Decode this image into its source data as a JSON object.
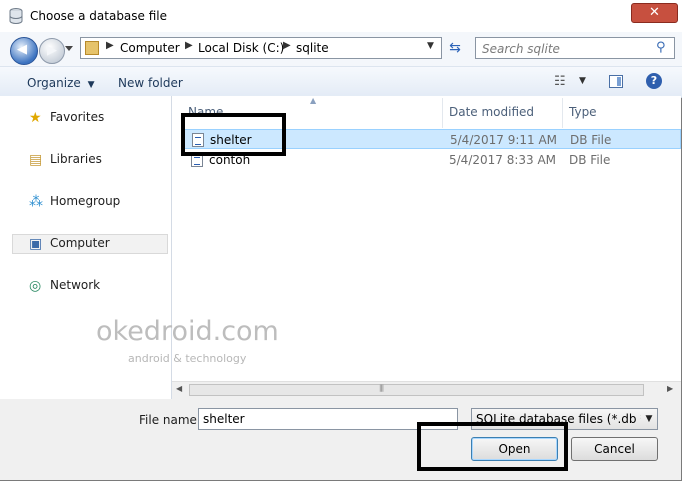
{
  "window": {
    "title": "Choose a database file",
    "close_glyph": "✕"
  },
  "address": {
    "crumbs": [
      "Computer",
      "Local Disk (C:)",
      "sqlite"
    ]
  },
  "search": {
    "placeholder": "Search sqlite"
  },
  "toolbar": {
    "organize_label": "Organize",
    "new_folder_label": "New folder"
  },
  "sidebar": {
    "items": [
      {
        "label": "Favorites",
        "icon": "star-icon"
      },
      {
        "label": "Libraries",
        "icon": "library-icon"
      },
      {
        "label": "Homegroup",
        "icon": "homegroup-icon"
      },
      {
        "label": "Computer",
        "icon": "computer-icon",
        "selected": true
      },
      {
        "label": "Network",
        "icon": "network-icon"
      }
    ]
  },
  "columns": {
    "name": "Name",
    "date": "Date modified",
    "type": "Type"
  },
  "files": [
    {
      "name": "shelter",
      "date": "5/4/2017 9:11 AM",
      "type": "DB File",
      "selected": true
    },
    {
      "name": "contoh",
      "date": "5/4/2017 8:33 AM",
      "type": "DB File",
      "selected": false
    }
  ],
  "watermark": {
    "brand": "okedroid.com",
    "tagline": "android & technology"
  },
  "footer": {
    "file_name_label": "File name:",
    "file_name_value": "shelter",
    "filter_value": "SQLite database files (*.db *.sql",
    "open_label": "Open",
    "cancel_label": "Cancel"
  },
  "colors": {
    "selection": "#cce8ff",
    "close_button": "#c7503f",
    "toolbar_text": "#1e395b"
  }
}
